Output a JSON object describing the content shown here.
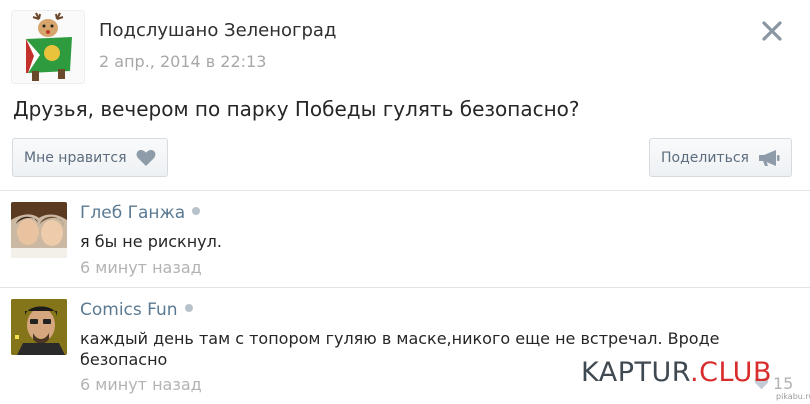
{
  "post": {
    "group_name": "Подслушано Зеленоград",
    "date": "2 апр., 2014 в 22:13",
    "text": "Друзья, вечером по парку Победы гулять безопасно?"
  },
  "actions": {
    "like_label": "Мне нравится",
    "share_label": "Поделиться"
  },
  "comments": [
    {
      "author": "Глеб Ганжа",
      "text": "я бы не рискнул.",
      "time": "6 минут назад"
    },
    {
      "author": "Comics Fun",
      "text": "каждый день там с топором гуляю в маске,никого еще не встречал. Вроде безопасно",
      "time": "6 минут назад",
      "likes": "15"
    }
  ],
  "watermark": {
    "text_main": "KAPTUR",
    "text_accent": ".CLUB",
    "small_mark": "pikabu.ru"
  },
  "colors": {
    "link": "#5a7a93",
    "button_text": "#5d6d7e",
    "muted": "#b3b3b3",
    "watermark_accent": "#d92c2c"
  },
  "icons": {
    "close": "close-icon",
    "like": "heart-icon",
    "share": "megaphone-icon",
    "online": "online-dot"
  }
}
